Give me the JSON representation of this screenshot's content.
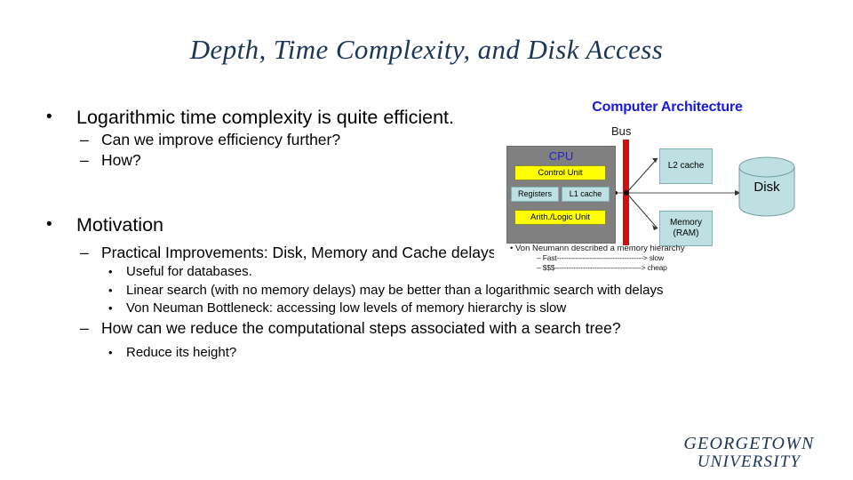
{
  "slide": {
    "title": "Depth, Time Complexity, and Disk Access",
    "title_color": "#1d3557",
    "background": "#ffffff"
  },
  "body": {
    "blocks": [
      {
        "level": 1,
        "marker": "•",
        "text": "Logarithmic time complexity is quite efficient."
      },
      {
        "level": 2,
        "marker": "–",
        "text": "Can we improve efficiency further?"
      },
      {
        "level": 2,
        "marker": "–",
        "text": "How?"
      },
      {
        "level": 1,
        "marker": "•",
        "text": "Motivation"
      },
      {
        "level": 2,
        "marker": "–",
        "text": "Practical Improvements: Disk, Memory and Cache delays"
      },
      {
        "level": 3,
        "marker": "•",
        "text": "Useful for databases."
      },
      {
        "level": 3,
        "marker": "•",
        "text": "Linear search (with no memory delays) may be better than a logarithmic search with delays"
      },
      {
        "level": 3,
        "marker": "•",
        "text": "Von Neuman Bottleneck: accessing low levels of memory hierarchy is slow"
      },
      {
        "level": 2,
        "marker": "–",
        "text": "How can we reduce the computational steps associated with a search tree?"
      },
      {
        "level": 3,
        "marker": "•",
        "text": "Reduce its height?"
      }
    ]
  },
  "figure": {
    "heading": "Computer Architecture",
    "heading_color": "#1a1ad6",
    "bus_label": "Bus",
    "bus_color": "#cc1111",
    "cpu": {
      "label": "CPU",
      "label_color": "#2222cc",
      "box_color": "#808080",
      "parts": [
        {
          "label": "Control Unit",
          "color": "#ffff00"
        },
        {
          "label": "Registers",
          "color": "#bfe0e3"
        },
        {
          "label": "L1 cache",
          "color": "#bfe0e3"
        },
        {
          "label": "Arith./Logic Unit",
          "color": "#ffff00"
        }
      ]
    },
    "memory": [
      {
        "label": "L2 cache",
        "color": "#bfe0e3"
      },
      {
        "label": "Memory\n(RAM)",
        "line1": "Memory",
        "line2": "(RAM)",
        "color": "#bfe0e3"
      }
    ],
    "disk": {
      "label": "Disk",
      "color": "#bfe0e3"
    },
    "caption": {
      "bullet": "•",
      "line1": "Von Neumann described a memory hierarchy",
      "dash": "–",
      "line2": "Fast-------------------------------------> slow",
      "line3": "$$$-------------------------------------> cheap"
    }
  },
  "logo": {
    "line1": "GEORGETOWN",
    "line2": "UNIVERSITY",
    "color": "#1d3557"
  }
}
